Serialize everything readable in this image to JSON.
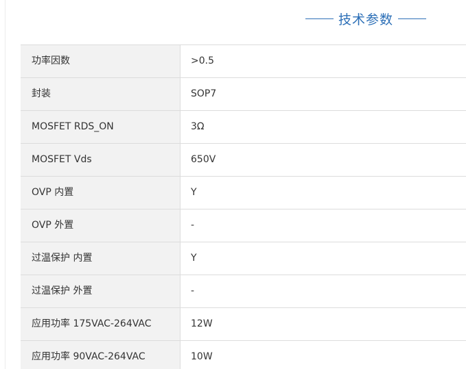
{
  "section": {
    "title": "技术参数"
  },
  "specs": [
    {
      "label": "功率因数",
      "value": ">0.5"
    },
    {
      "label": "封装",
      "value": "SOP7"
    },
    {
      "label": "MOSFET RDS_ON",
      "value": "3Ω"
    },
    {
      "label": "MOSFET Vds",
      "value": "650V"
    },
    {
      "label": "OVP 内置",
      "value": "Y"
    },
    {
      "label": "OVP 外置",
      "value": "-"
    },
    {
      "label": "过温保护 内置",
      "value": "Y"
    },
    {
      "label": "过温保护 外置",
      "value": "-"
    },
    {
      "label": "应用功率 175VAC-264VAC",
      "value": "12W"
    },
    {
      "label": "应用功率 90VAC-264VAC",
      "value": "10W"
    }
  ],
  "colors": {
    "accent": "#2c6fb7",
    "label_bg": "#f2f2f2",
    "border": "#dcdcdc",
    "text": "#333333"
  }
}
